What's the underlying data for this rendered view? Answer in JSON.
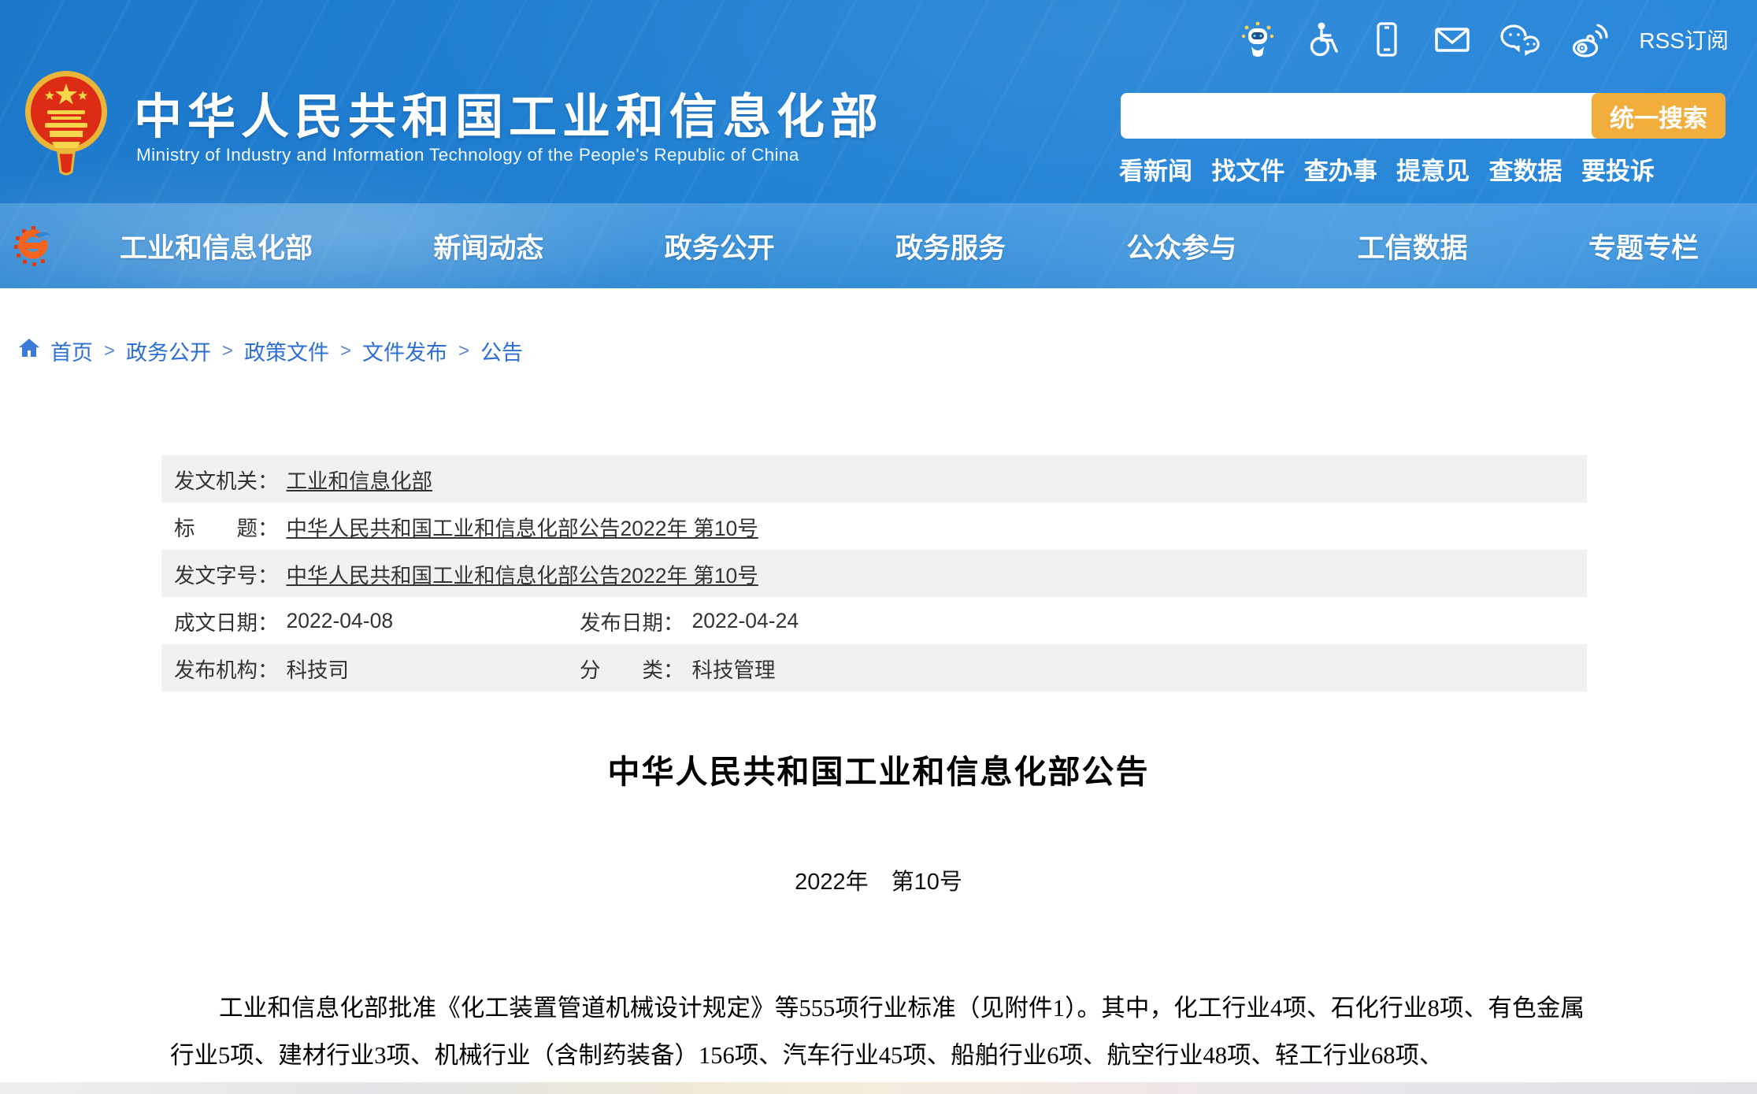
{
  "header": {
    "ministry_title": "中华人民共和国工业和信息化部",
    "ministry_subtitle_en": "Ministry of Industry and Information Technology of the People's Republic of China",
    "rss_label": "RSS订阅",
    "search": {
      "value": "",
      "button_label": "统一搜索"
    },
    "quick_links": [
      "看新闻",
      "找文件",
      "查办事",
      "提意见",
      "查数据",
      "要投诉"
    ],
    "icons": [
      "robot-assistant-icon",
      "accessibility-icon",
      "mobile-icon",
      "mail-icon",
      "wechat-icon",
      "weibo-icon"
    ],
    "colors": {
      "header_blue": "#2181d3",
      "search_button_gold": "#f2ae3d"
    }
  },
  "nav": {
    "items": [
      "工业和信息化部",
      "新闻动态",
      "政务公开",
      "政务服务",
      "公众参与",
      "工信数据",
      "专题专栏"
    ]
  },
  "breadcrumb": {
    "separator": ">",
    "items": [
      "首页",
      "政务公开",
      "政策文件",
      "文件发布",
      "公告"
    ]
  },
  "meta_table": {
    "rows": [
      {
        "label": "发文机关：",
        "value": "工业和信息化部"
      },
      {
        "label": "标　　题：",
        "value": "中华人民共和国工业和信息化部公告2022年 第10号"
      },
      {
        "label": "发文字号：",
        "value": "中华人民共和国工业和信息化部公告2022年 第10号"
      },
      {
        "label": "成文日期：",
        "value": "2022-04-08",
        "label2": "发布日期：",
        "value2": "2022-04-24"
      },
      {
        "label": "发布机构：",
        "value": "科技司",
        "label2": "分　　类：",
        "value2": "科技管理"
      }
    ]
  },
  "document": {
    "title": "中华人民共和国工业和信息化部公告",
    "issue_no": "2022年　第10号",
    "body": "工业和信息化部批准《化工装置管道机械设计规定》等555项行业标准（见附件1）。其中，化工行业4项、石化行业8项、有色金属行业5项、建材行业3项、机械行业（含制药装备）156项、汽车行业45项、船舶行业6项、航空行业48项、轻工行业68项、"
  }
}
